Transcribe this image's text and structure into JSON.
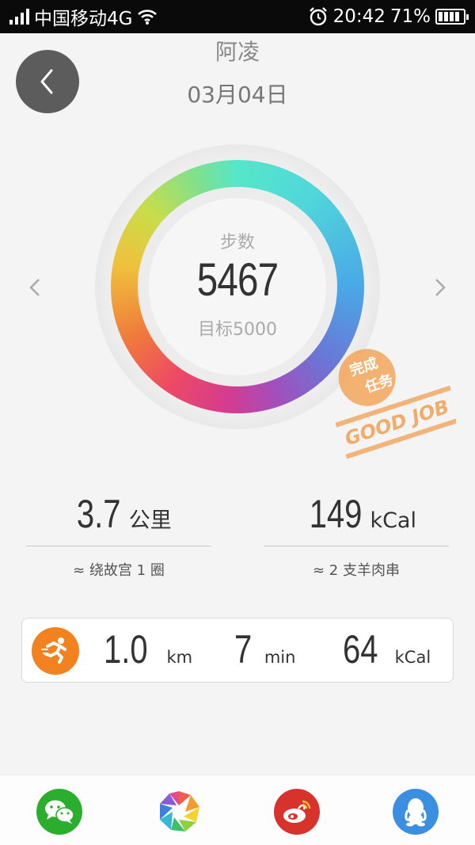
{
  "status_bar": {
    "carrier": "中国移动4G",
    "time": "20:42",
    "battery": "71%"
  },
  "header": {
    "name": "阿凌",
    "date": "03月04日"
  },
  "ring": {
    "label": "步数",
    "steps": "5467",
    "goal": "目标5000",
    "progress": 1.0
  },
  "stamp": {
    "line1": "完成",
    "line2": "任务",
    "line3": "GOOD JOB",
    "color": "#f2a45a"
  },
  "stats": {
    "distance": {
      "value": "3.7",
      "unit": "公里",
      "note": "≈ 绕故宫 1 圈"
    },
    "calories": {
      "value": "149",
      "unit": "kCal",
      "note": "≈ 2 支羊肉串"
    }
  },
  "activity": {
    "icon": "running-icon",
    "distance": {
      "value": "1.0",
      "unit": "km"
    },
    "duration": {
      "value": "7",
      "unit": "min"
    },
    "calories": {
      "value": "64",
      "unit": "kCal"
    }
  },
  "share": [
    "wechat-icon",
    "moments-icon",
    "weibo-icon",
    "qq-icon"
  ]
}
